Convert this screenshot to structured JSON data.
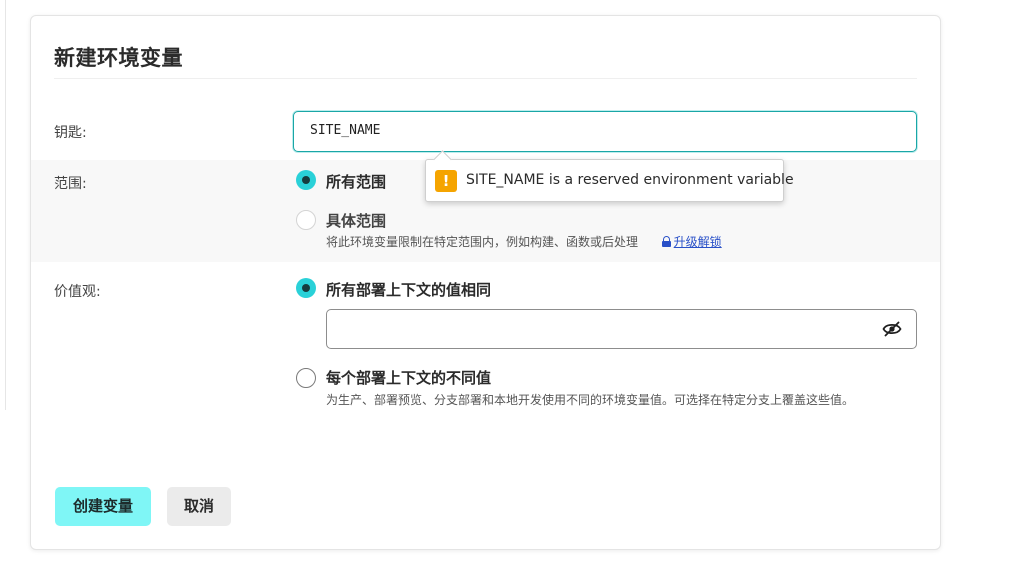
{
  "dialog": {
    "title": "新建环境变量"
  },
  "key_field": {
    "label": "钥匙:",
    "value": "SITE_NAME"
  },
  "tooltip": {
    "icon": "warning-icon",
    "icon_glyph": "!",
    "text": "SITE_NAME is a reserved environment variable"
  },
  "scope": {
    "label": "范围:",
    "options": [
      {
        "label": "所有范围",
        "selected": true
      },
      {
        "label": "具体范围",
        "selected": false,
        "disabled": true
      }
    ],
    "specific_help": "将此环境变量限制在特定范围内，例如构建、函数或后处理",
    "upgrade_link": "升级解锁"
  },
  "values": {
    "label": "价值观:",
    "options": [
      {
        "label": "所有部署上下文的值相同",
        "selected": true
      },
      {
        "label": "每个部署上下文的不同值",
        "selected": false
      }
    ],
    "input_value": "",
    "per_context_help": "为生产、部署预览、分支部署和本地开发使用不同的环境变量值。可选择在特定分支上覆盖这些值。"
  },
  "actions": {
    "create_label": "创建变量",
    "cancel_label": "取消"
  },
  "colors": {
    "accent": "#2ad1d8",
    "primary_button": "#7ff6f6",
    "warning": "#f5a400",
    "link": "#2950c8"
  }
}
